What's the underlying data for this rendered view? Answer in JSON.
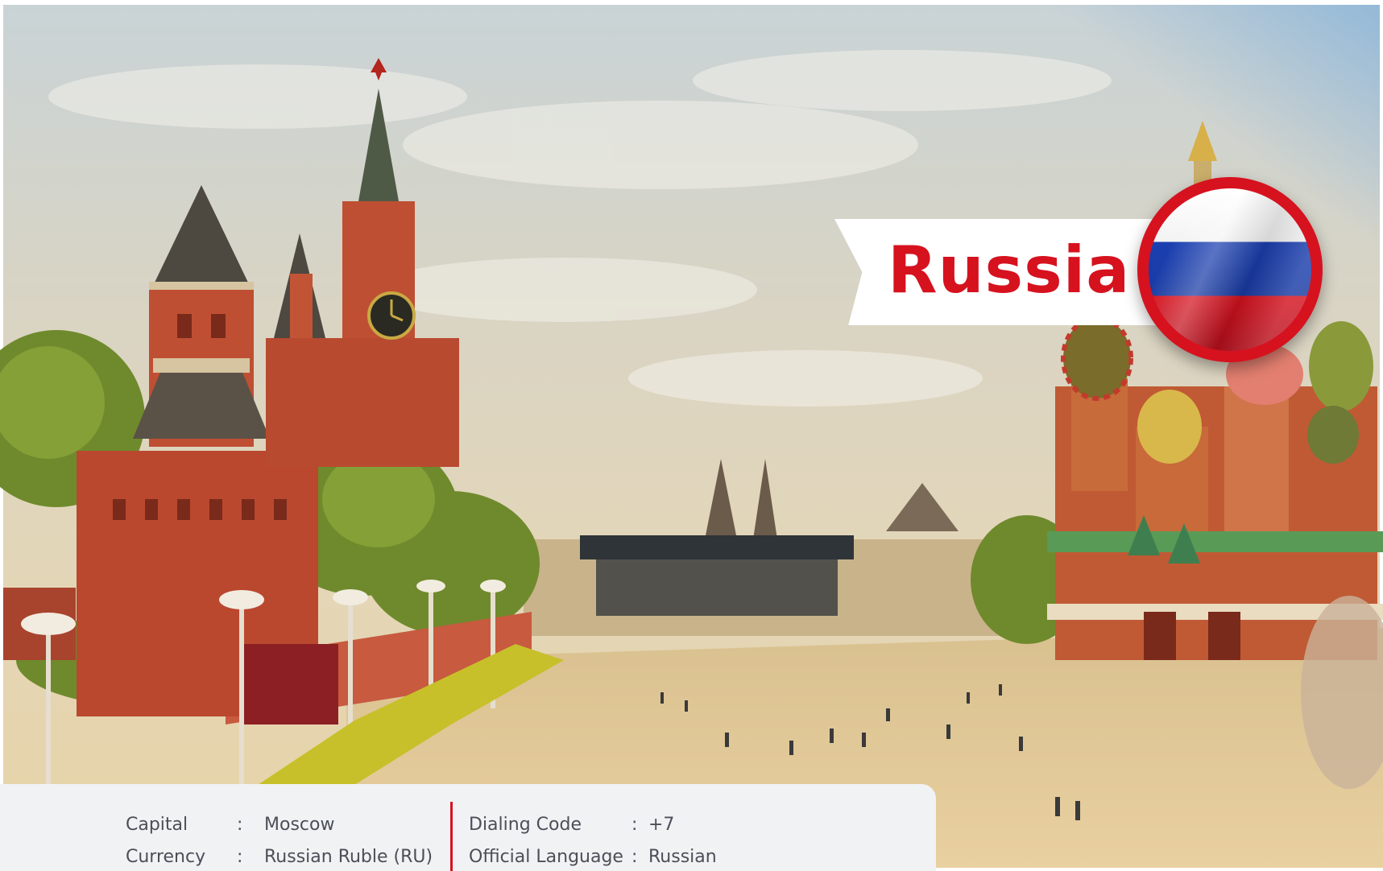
{
  "country": {
    "name": "Russia",
    "flag_icon": "russia-flag-icon",
    "flag_colors": [
      "#ffffff",
      "#1b3fb0",
      "#d6121f"
    ]
  },
  "info": {
    "capital_label": "Capital",
    "capital_value": "Moscow",
    "currency_label": "Currency",
    "currency_value": "Russian Ruble (RU)",
    "dialing_label": "Dialing Code",
    "dialing_value": "+7",
    "language_label": "Official Language",
    "language_value": "Russian",
    "separator": ":"
  },
  "colors": {
    "accent": "#d6121f",
    "panel_bg": "#f1f2f4",
    "text": "#4a4f58"
  }
}
